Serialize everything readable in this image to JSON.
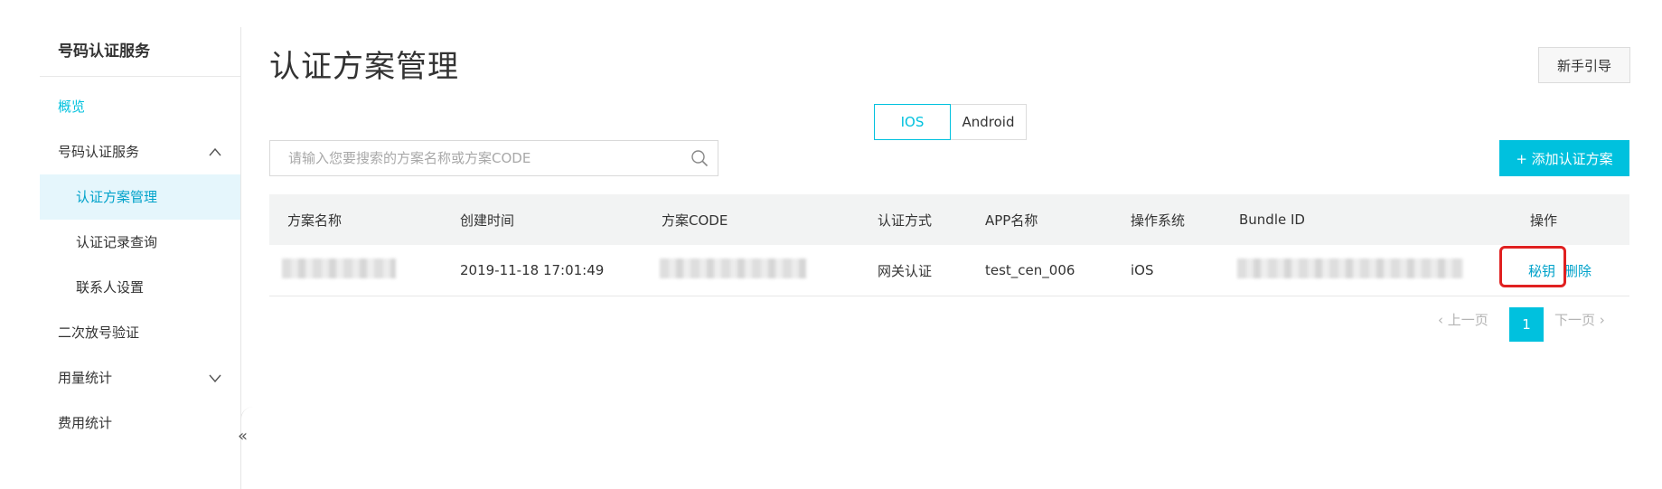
{
  "sidebar": {
    "title": "号码认证服务",
    "items": [
      {
        "label": "概览"
      },
      {
        "label": "号码认证服务"
      },
      {
        "label": "认证方案管理"
      },
      {
        "label": "认证记录查询"
      },
      {
        "label": "联系人设置"
      },
      {
        "label": "二次放号验证"
      },
      {
        "label": "用量统计"
      },
      {
        "label": "费用统计"
      }
    ],
    "collapse_glyph": "«"
  },
  "header": {
    "title": "认证方案管理",
    "guide_button": "新手引导"
  },
  "platform_tabs": {
    "ios": "IOS",
    "android": "Android",
    "selected": "IOS"
  },
  "search": {
    "placeholder": "请输入您要搜索的方案名称或方案CODE",
    "value": ""
  },
  "add_button": "+ 添加认证方案",
  "table": {
    "columns": [
      "方案名称",
      "创建时间",
      "方案CODE",
      "认证方式",
      "APP名称",
      "操作系统",
      "Bundle ID",
      "操作"
    ],
    "rows": [
      {
        "created": "2019-11-18 17:01:49",
        "auth_method": "网关认证",
        "app_name": "test_cen_006",
        "os": "iOS",
        "actions": {
          "secret": "秘钥",
          "delete": "删除"
        }
      }
    ]
  },
  "pagination": {
    "prev": "上一页",
    "current": "1",
    "next": "下一页"
  },
  "colors": {
    "accent": "#00c1de",
    "highlight": "#e02020"
  }
}
